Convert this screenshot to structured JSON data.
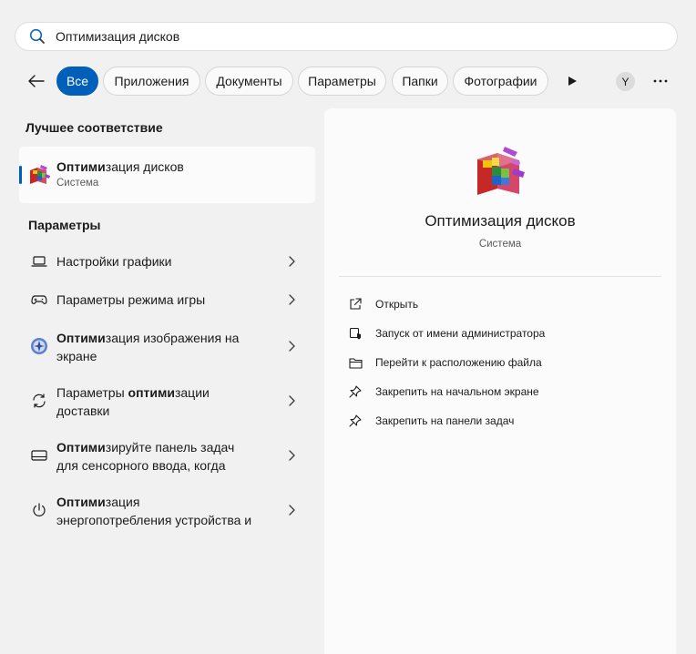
{
  "search": {
    "value": "Оптимизация дисков",
    "icon": "search-icon"
  },
  "filters": {
    "tabs": [
      {
        "label": "Все",
        "active": true
      },
      {
        "label": "Приложения"
      },
      {
        "label": "Документы"
      },
      {
        "label": "Параметры"
      },
      {
        "label": "Папки"
      },
      {
        "label": "Фотографии"
      }
    ],
    "avatar_initial": "Y"
  },
  "best_match": {
    "heading": "Лучшее соответствие",
    "name_bold": "Оптими",
    "name_rest": "зация дисков",
    "subtitle": "Система"
  },
  "settings": {
    "heading": "Параметры",
    "items": [
      {
        "icon": "laptop-icon",
        "line1_pre": "Настройки графики",
        "line1_bold": "",
        "line1_post": "",
        "line2": ""
      },
      {
        "icon": "gamepad-icon",
        "line1_pre": "Параметры режима игры",
        "line1_bold": "",
        "line1_post": "",
        "line2": ""
      },
      {
        "icon": "display-calibration-icon",
        "line1_pre": "",
        "line1_bold": "Оптими",
        "line1_post": "зация изображения на",
        "line2": "экране"
      },
      {
        "icon": "sync-icon",
        "line1_pre": "Параметры ",
        "line1_bold": "оптими",
        "line1_post": "зации",
        "line2": "доставки"
      },
      {
        "icon": "keyboard-icon",
        "line1_pre": "",
        "line1_bold": "Оптими",
        "line1_post": "зируйте панель задач",
        "line2": "для сенсорного ввода, когда"
      },
      {
        "icon": "power-icon",
        "line1_pre": "",
        "line1_bold": "Оптими",
        "line1_post": "зация",
        "line2": "энергопотребления устройства и"
      }
    ]
  },
  "detail": {
    "title": "Оптимизация дисков",
    "subtitle": "Система",
    "actions": [
      {
        "icon": "open-icon",
        "label": "Открыть"
      },
      {
        "icon": "shield-icon",
        "label": "Запуск от имени администратора"
      },
      {
        "icon": "folder-icon",
        "label": "Перейти к расположению файла"
      },
      {
        "icon": "pin-icon",
        "label": "Закрепить на начальном экране"
      },
      {
        "icon": "pin-icon",
        "label": "Закрепить на панели задач"
      }
    ]
  },
  "colors": {
    "accent": "#005fb8",
    "panel": "#fbfbfb",
    "background": "#f1f1f1"
  }
}
